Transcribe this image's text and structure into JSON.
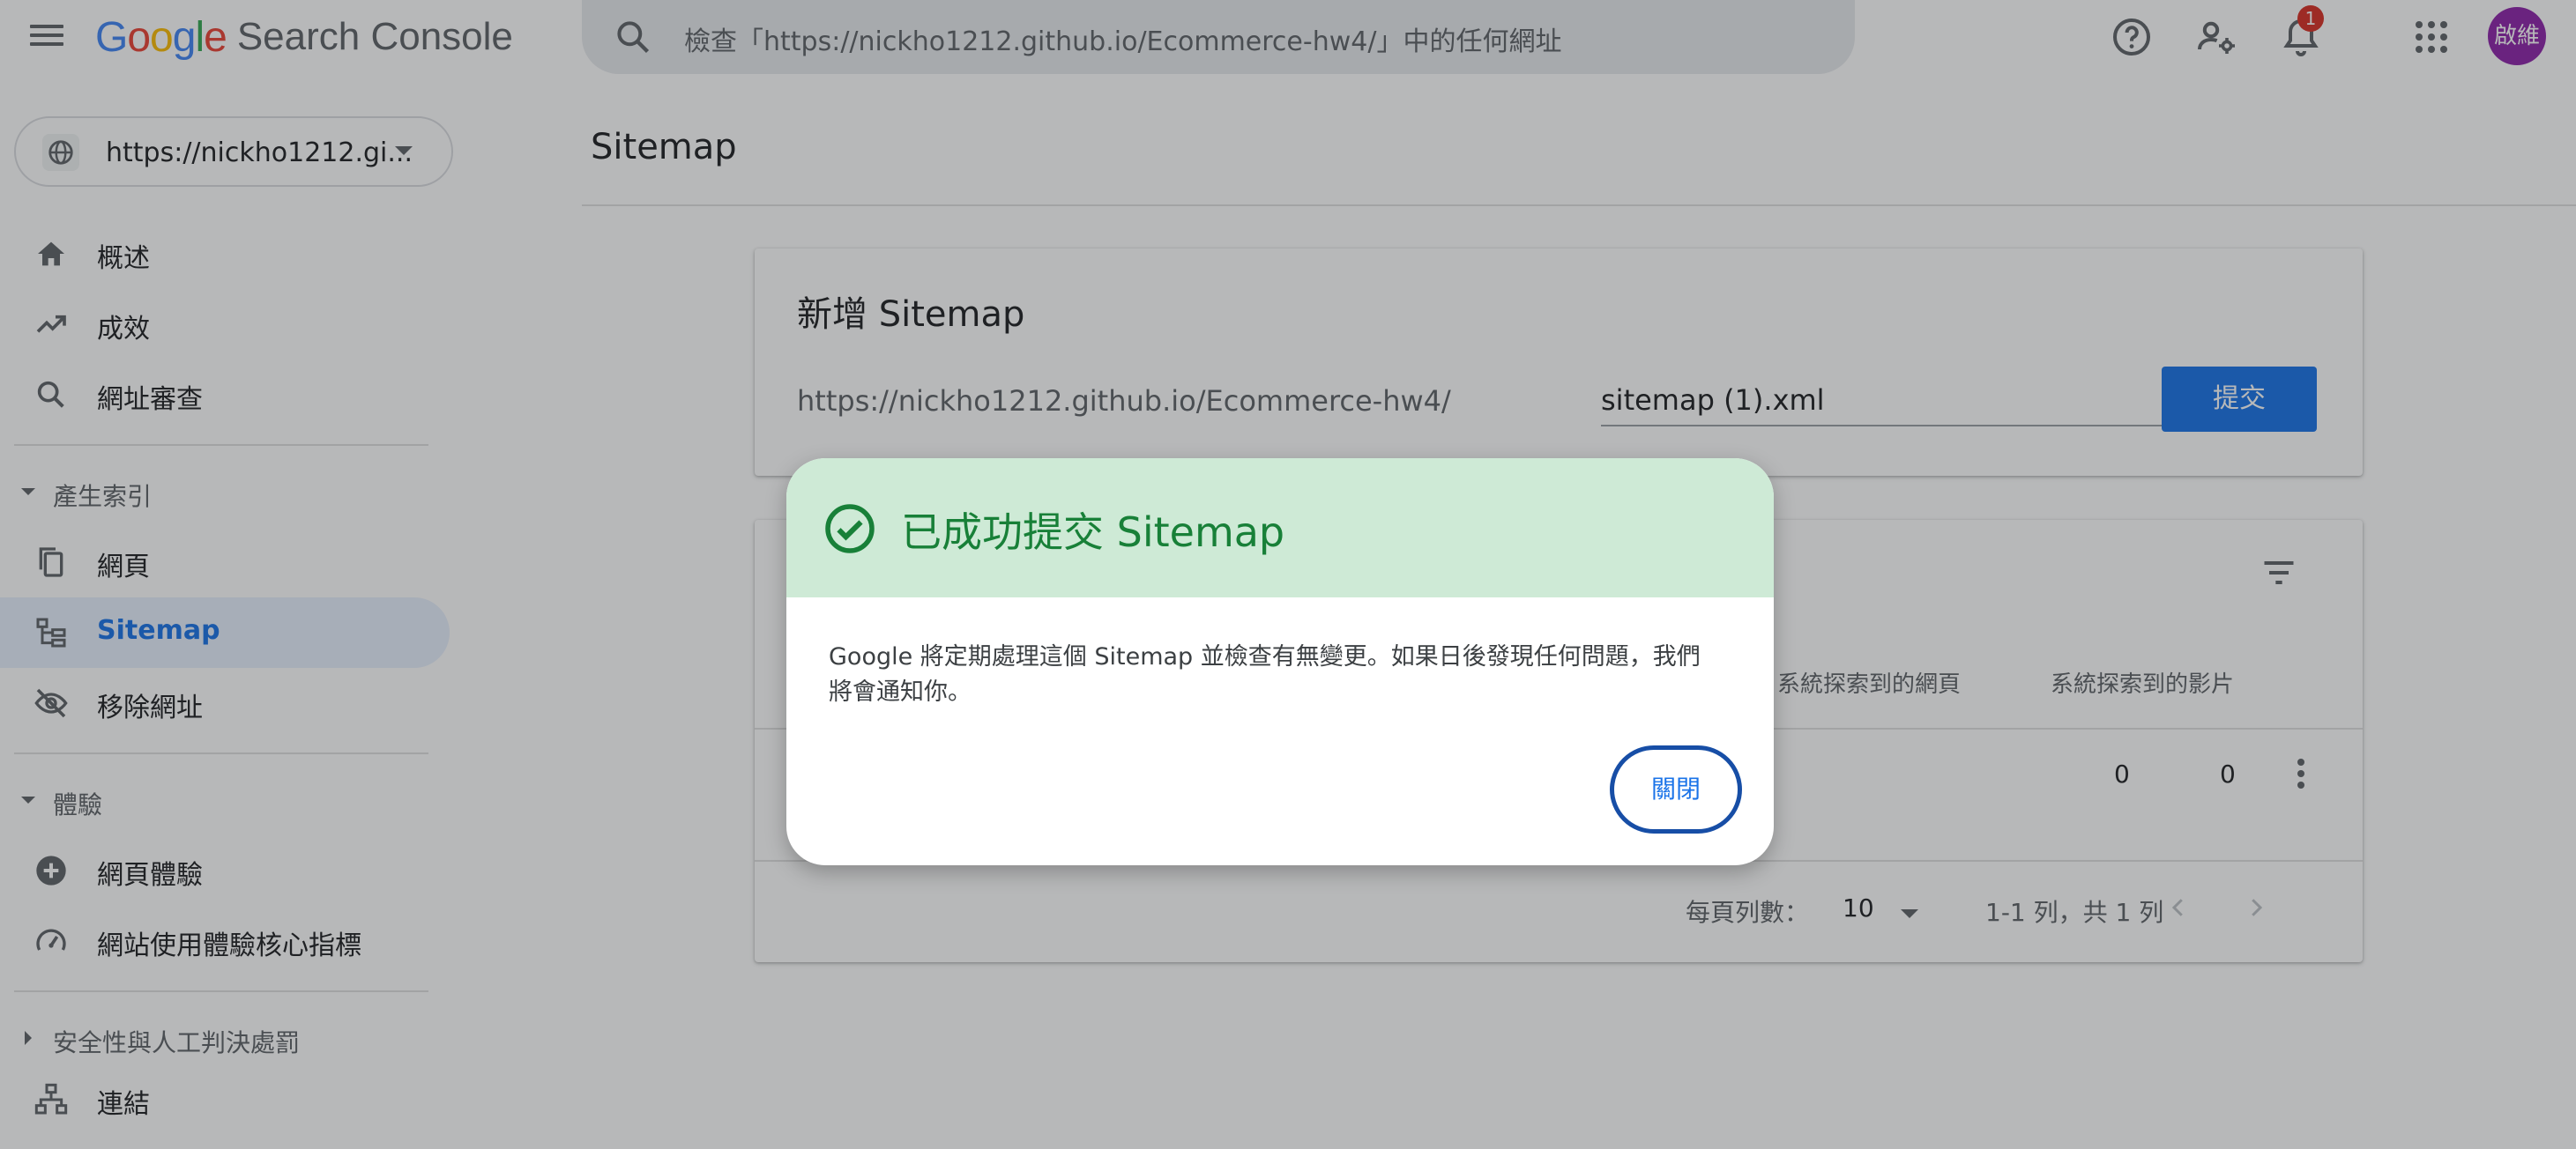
{
  "header": {
    "logo_google": "Google",
    "logo_product": "Search Console",
    "search_placeholder": "檢查「https://nickho1212.github.io/Ecommerce-hw4/」中的任何網址",
    "notification_count": "1",
    "avatar_text": "啟維",
    "icons": [
      "menu-icon",
      "search-icon",
      "help-icon",
      "manage-users-icon",
      "notifications-icon",
      "apps-icon"
    ]
  },
  "sidebar": {
    "property_label": "https://nickho1212.gi...",
    "items": [
      {
        "label": "概述",
        "icon": "home-icon"
      },
      {
        "label": "成效",
        "icon": "trending-up-icon"
      },
      {
        "label": "網址審查",
        "icon": "search-icon"
      }
    ],
    "sections": [
      {
        "title": "產生索引",
        "items": [
          {
            "label": "網頁",
            "icon": "pages-icon"
          },
          {
            "label": "Sitemap",
            "icon": "sitemap-icon",
            "active": true
          },
          {
            "label": "移除網址",
            "icon": "visibility-off-icon"
          }
        ]
      },
      {
        "title": "體驗",
        "items": [
          {
            "label": "網頁體驗",
            "icon": "plus-circle-icon"
          },
          {
            "label": "網站使用體驗核心指標",
            "icon": "speed-icon"
          }
        ]
      },
      {
        "title": "安全性與人工判決處罰",
        "items": []
      }
    ],
    "bottom_item": {
      "label": "連結",
      "icon": "link-tree-icon"
    }
  },
  "main": {
    "page_title": "Sitemap",
    "add_card": {
      "title": "新增 Sitemap",
      "url_prefix": "https://nickho1212.github.io/Ecommerce-hw4/",
      "input_value": "sitemap (1).xml",
      "submit_label": "提交"
    },
    "table": {
      "columns": [
        "系統探索到的網頁",
        "系統探索到的影片"
      ],
      "rows": [
        {
          "pages": "0",
          "videos": "0"
        }
      ],
      "rows_per_page_label": "每頁列數：",
      "rows_per_page_value": "10",
      "range_text": "1-1 列，共 1 列"
    }
  },
  "dialog": {
    "title": "已成功提交 Sitemap",
    "body": "Google 將定期處理這個 Sitemap 並檢查有無變更。如果日後發現任何問題，我們將會通知你。",
    "close_label": "關閉",
    "accent_color": "#188038",
    "header_bg": "#ceead6"
  },
  "colors": {
    "primary": "#1a73e8",
    "active_nav_bg": "#e8f0fe",
    "badge": "#d93025",
    "avatar_bg": "#8e24aa"
  }
}
